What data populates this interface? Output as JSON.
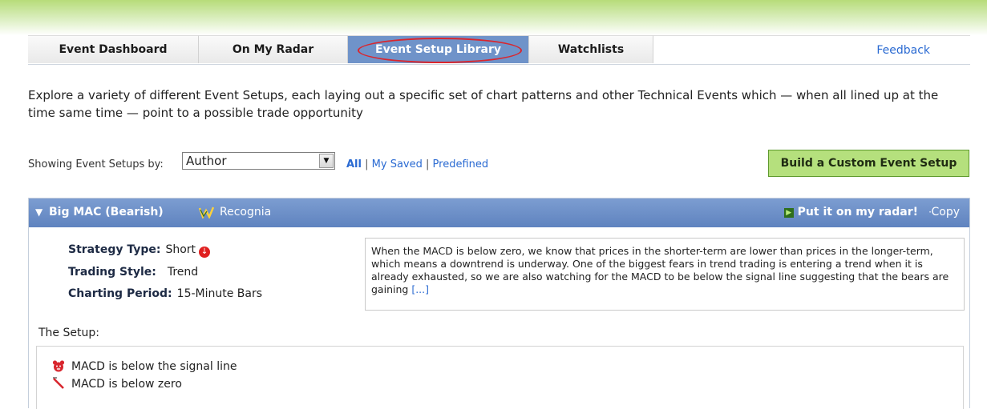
{
  "tabs": [
    {
      "label": "Event Dashboard"
    },
    {
      "label": "On My Radar"
    },
    {
      "label": "Event Setup Library"
    },
    {
      "label": "Watchlists"
    }
  ],
  "feedback_label": "Feedback",
  "intro_text": "Explore a variety of different Event Setups, each laying out a specific set of chart patterns and other Technical Events which — when all lined up at the time same time — point to a possible trade opportunity",
  "filter": {
    "label": "Showing Event Setups by:",
    "selected": "Author",
    "all": "All",
    "sep": "|",
    "my_saved": "My Saved",
    "predefined": "Predefined"
  },
  "build_button": "Build a Custom Event Setup",
  "setup": {
    "title": "Big MAC (Bearish)",
    "source": "Recognia",
    "radar_label": "Put it on my radar!",
    "dot": "·",
    "copy_label": "Copy",
    "strategy_key": "Strategy Type:",
    "strategy_val": "Short",
    "style_key": "Trading Style:",
    "style_val": "Trend",
    "period_key": "Charting Period:",
    "period_val": "15-Minute Bars",
    "description": "When the MACD is below zero, we know that prices in the shorter-term are lower than prices in the longer-term, which means a downtrend is underway. One of the biggest fears in trend trading is entering a trend when it is already exhausted, so we are also watching for the MACD to be below the signal line suggesting that the bears are gaining",
    "more": "[...]",
    "setup_label": "The Setup:",
    "conditions": [
      {
        "text": "MACD is below the signal line",
        "icon": "bear-icon"
      },
      {
        "text": "MACD is below zero",
        "icon": "below-zero-icon"
      }
    ]
  },
  "colors": {
    "accent": "#6f93c9",
    "build": "#b5e07d",
    "link": "#2a6ad2",
    "highlight_ring": "#d9262e"
  }
}
